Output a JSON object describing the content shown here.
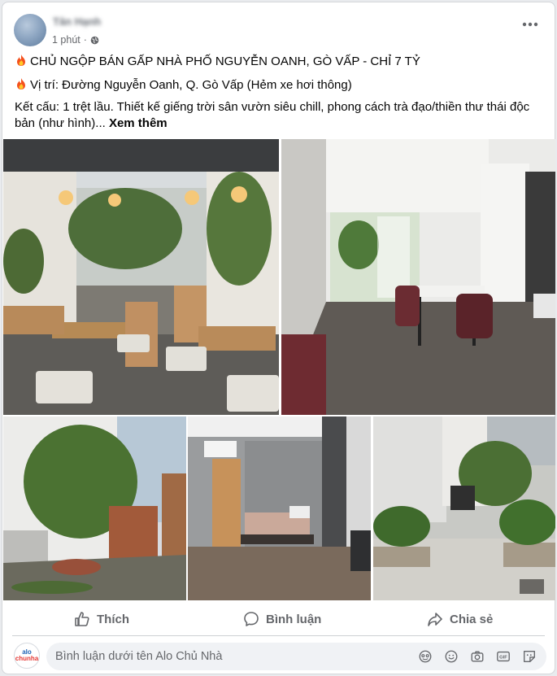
{
  "post": {
    "author": "Tân Hạnh",
    "time": "1 phút",
    "title_line": "CHỦ NGỘP BÁN GẤP NHÀ PHỐ NGUYỄN OANH, GÒ VẤP - CHỈ 7 TỶ",
    "location_line": "Vị trí: Đường Nguyễn Oanh, Q. Gò Vấp (Hẻm xe hơi thông)",
    "body": "Kết cấu: 1 trệt lầu. Thiết kế giếng trời sân vườn siêu chill, phong cách trà đạo/thiền thư thái độc bản (như hình)...",
    "see_more": "Xem thêm"
  },
  "actions": {
    "like": "Thích",
    "comment": "Bình luận",
    "share": "Chia sẻ"
  },
  "comment_box": {
    "placeholder": "Bình luận dưới tên Alo Chủ Nhà",
    "avatar_line1": "alo",
    "avatar_line2": "chunha"
  },
  "icons": [
    "globe-icon",
    "more-icon",
    "fire-icon",
    "like-icon",
    "comment-icon",
    "share-icon",
    "avatar-frame-icon",
    "emoji-icon",
    "camera-icon",
    "gif-icon",
    "sticker-icon"
  ],
  "colors": {
    "secondary_text": "#65676b",
    "input_bg": "#f0f2f5",
    "divider": "#ced0d4"
  }
}
